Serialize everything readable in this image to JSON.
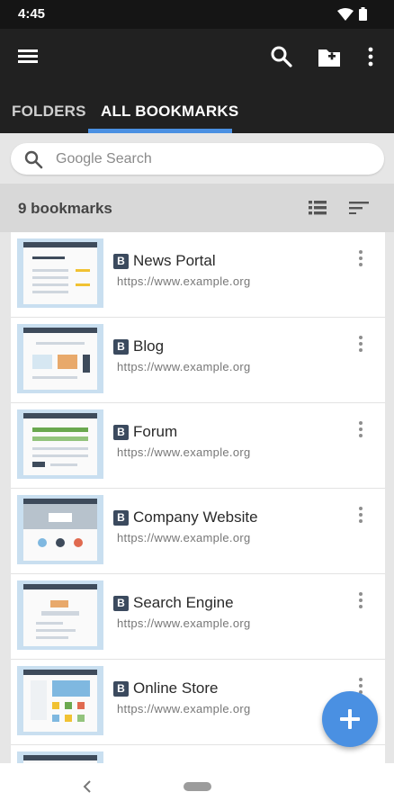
{
  "status_bar": {
    "time": "4:45"
  },
  "tabs": [
    {
      "label": "FOLDERS",
      "selected": false
    },
    {
      "label": "ALL BOOKMARKS",
      "selected": true
    }
  ],
  "search": {
    "placeholder": "Google Search"
  },
  "list_header": {
    "count": "9 bookmarks"
  },
  "bookmarks": [
    {
      "title": "News Portal",
      "url": "https://www.example.org"
    },
    {
      "title": "Blog",
      "url": "https://www.example.org"
    },
    {
      "title": "Forum",
      "url": "https://www.example.org"
    },
    {
      "title": "Company Website",
      "url": "https://www.example.org"
    },
    {
      "title": "Search Engine",
      "url": "https://www.example.org"
    },
    {
      "title": "Online Store",
      "url": "https://www.example.org"
    }
  ],
  "site_badge_letter": "B",
  "colors": {
    "accent": "#4a90e2",
    "app_bar": "#212121",
    "badge": "#3b4a5e"
  },
  "icons": {
    "menu": "menu-icon",
    "search": "search-icon",
    "new_folder": "folder-add-icon",
    "overflow": "more-vert-icon",
    "list_view": "list-view-icon",
    "sort": "sort-icon",
    "fab": "add-icon"
  }
}
